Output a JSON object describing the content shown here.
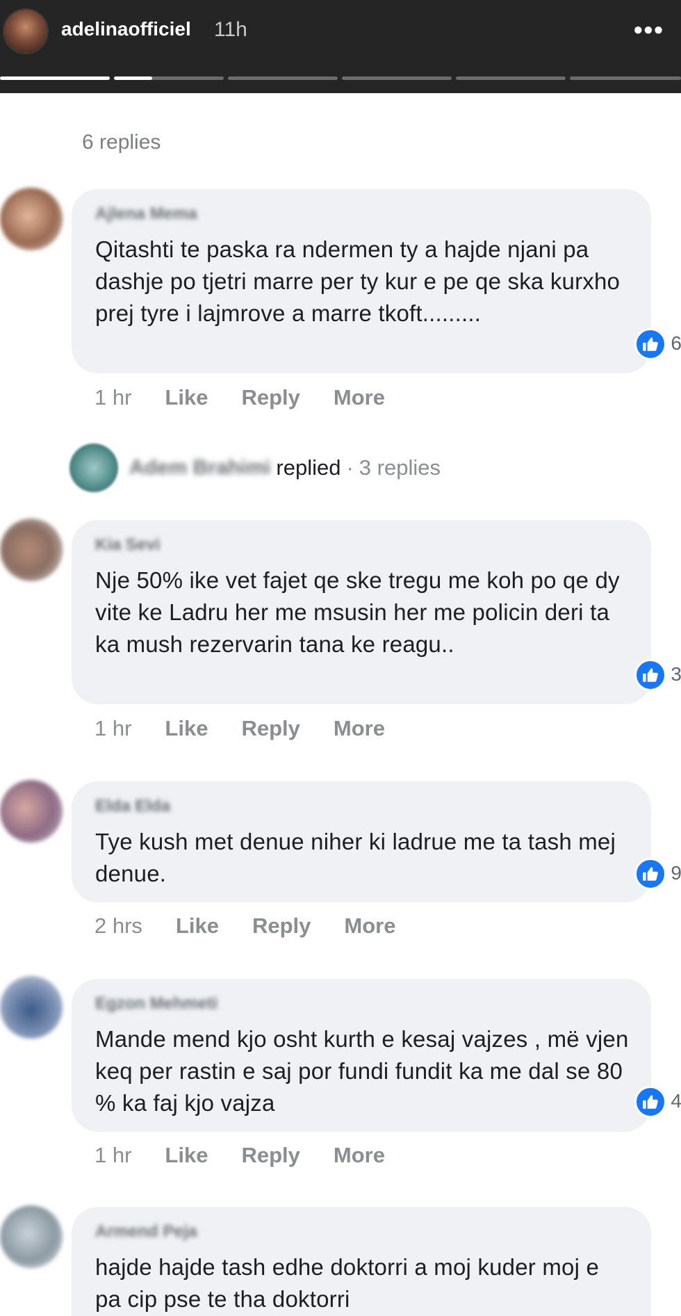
{
  "story": {
    "username": "adelinaofficiel",
    "time": "11h",
    "more_icon": "more-dots-icon",
    "progress_segments": [
      1,
      1,
      0,
      0,
      0,
      0
    ]
  },
  "thread": {
    "top_replies_label": "6 replies",
    "replied": {
      "name": "Adem Brahimi",
      "verb": "replied",
      "separator": "·",
      "count": "3 replies"
    },
    "comments": [
      {
        "author": "Ajlena Mema",
        "text": "Qitashti te paska ra ndermen ty a hajde njani pa dashje po tjetri marre per ty kur e pe qe ska kurxho prej tyre i lajmrove a marre tkoft.........",
        "reaction_count": "6",
        "time": "1 hr",
        "like": "Like",
        "reply": "Reply",
        "more": "More"
      },
      {
        "author": "Kia Sevi",
        "text": "Nje 50% ike vet fajet qe ske tregu me koh po qe dy vite ke Ladru her me msusin her me policin deri ta ka mush rezervarin tana ke reagu..",
        "reaction_count": "3",
        "time": "1 hr",
        "like": "Like",
        "reply": "Reply",
        "more": "More"
      },
      {
        "author": "Elda Elda",
        "text": "Tye kush met denue niher ki ladrue me ta tash mej denue.",
        "reaction_count": "9",
        "time": "2 hrs",
        "like": "Like",
        "reply": "Reply",
        "more": "More"
      },
      {
        "author": "Egzon Mehmeti",
        "text": "Mande mend kjo osht kurth e kesaj vajzes , më vjen keq per rastin e saj por fundi fundit ka me dal se 80 % ka faj kjo vajza",
        "reaction_count": "4",
        "time": "1 hr",
        "like": "Like",
        "reply": "Reply",
        "more": "More"
      },
      {
        "author": "Armend Peja",
        "text": "hajde hajde tash edhe doktorri a moj kuder moj e pa cip pse te tha doktorri"
      }
    ]
  },
  "colors": {
    "header_bg": "#252525",
    "bubble_bg": "#eff1f4",
    "like_blue": "#1877f2",
    "meta_gray": "#8a8d91"
  }
}
